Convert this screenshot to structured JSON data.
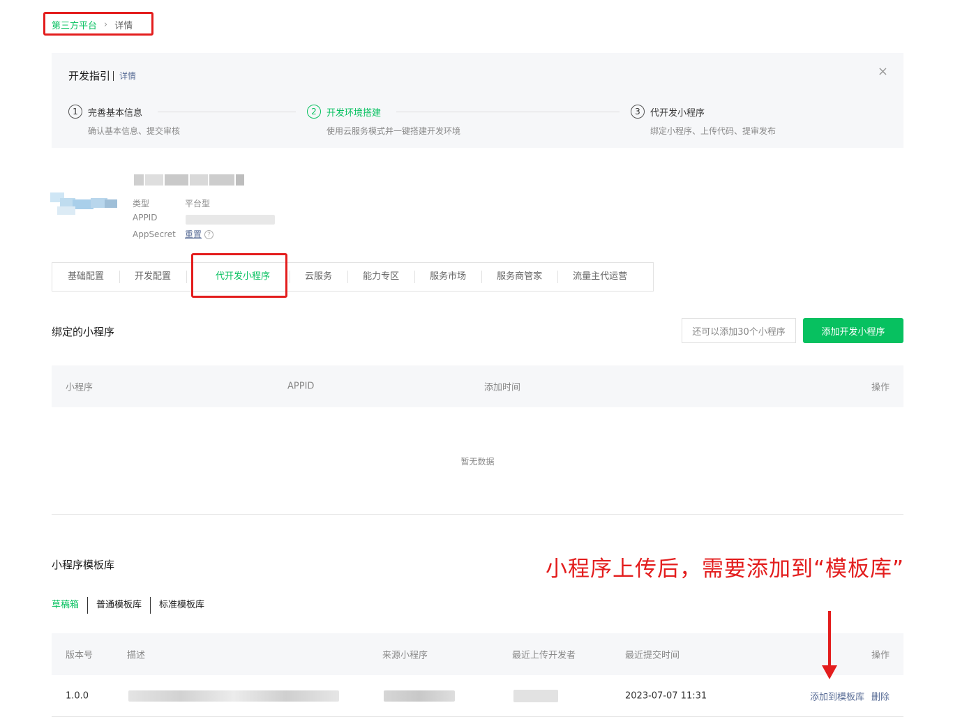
{
  "breadcrumb": {
    "root": "第三方平台",
    "separator": "›",
    "current": "详情"
  },
  "guide": {
    "title": "开发指引",
    "detail_link": "详情",
    "close": "×",
    "steps": [
      {
        "num": "1",
        "label": "完善基本信息",
        "desc": "确认基本信息、提交审核"
      },
      {
        "num": "2",
        "label": "开发环境搭建",
        "desc": "使用云服务模式并一键搭建开发环境"
      },
      {
        "num": "3",
        "label": "代开发小程序",
        "desc": "绑定小程序、上传代码、提审发布"
      }
    ]
  },
  "account": {
    "type_key": "类型",
    "type_value": "平台型",
    "appid_key": "APPID",
    "secret_key": "AppSecret",
    "secret_action": "重置",
    "help": "?"
  },
  "tabs": [
    "基础配置",
    "开发配置",
    "代开发小程序",
    "云服务",
    "能力专区",
    "服务市场",
    "服务商管家",
    "流量主代运营"
  ],
  "bound": {
    "title": "绑定的小程序",
    "quota": "还可以添加30个小程序",
    "add_button": "添加开发小程序",
    "columns": [
      "小程序",
      "APPID",
      "添加时间",
      "操作"
    ],
    "empty": "暂无数据"
  },
  "templates": {
    "title": "小程序模板库",
    "subtabs": [
      "草稿箱",
      "普通模板库",
      "标准模板库"
    ],
    "columns": [
      "版本号",
      "描述",
      "来源小程序",
      "最近上传开发者",
      "最近提交时间",
      "操作"
    ],
    "rows": [
      {
        "version": "1.0.0",
        "time": "2023-07-07 11:31",
        "action_add": "添加到模板库",
        "action_delete": "删除"
      }
    ]
  },
  "annotation": {
    "text": "小程序上传后，需要添加到“模板库”"
  },
  "colors": {
    "accent": "#07c160",
    "link": "#576b95",
    "annotation": "#e31d1d"
  }
}
